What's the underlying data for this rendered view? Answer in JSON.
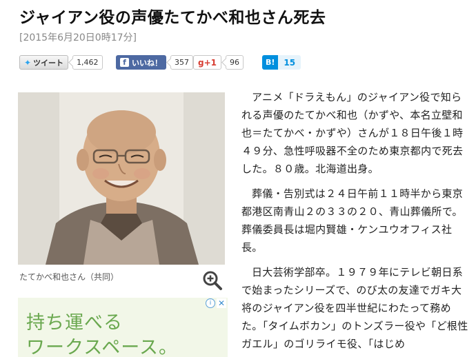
{
  "headline": "ジャイアン役の声優たてかべ和也さん死去",
  "dateline": "[2015年6月20日0時17分]",
  "share": {
    "twitter_label": "ツイート",
    "twitter_count": "1,462",
    "facebook_label": "いいね！",
    "facebook_count": "357",
    "gplus_label": "+1",
    "gplus_count": "96",
    "hatena_label": "B!",
    "hatena_count": "15"
  },
  "photo": {
    "caption": "たてかべ和也さん（共同）"
  },
  "ad": {
    "line1": "持ち運べる",
    "line2": "ワークスペース。",
    "info_icon": "i",
    "close_icon": "✕"
  },
  "article": {
    "paragraphs": [
      "アニメ「ドラえもん」のジャイアン役で知られる声優のたてかべ和也（かずや、本名立壁和也＝たてかべ・かずや）さんが１８日午後１時４９分、急性呼吸器不全のため東京都内で死去した。８０歳。北海道出身。",
      "葬儀・告別式は２４日午前１１時半から東京都港区南青山２の３３の２０、青山葬儀所で。葬儀委員長は堀内賢雄・ケンユウオフィス社長。",
      "日大芸術学部卒。１９７９年にテレビ朝日系で始まったシリーズで、のび太の友達でガキ大将のジャイアン役を四半世紀にわたって務めた。「タイムボカン」のトンズラー役や「ど根性ガエル」のゴリライモ役、「はじめ"
    ]
  },
  "colors": {
    "facebook": "#4d69a2",
    "hatena": "#008fde",
    "gplus": "#d73d32",
    "ad_text": "#6aa84f"
  },
  "icons": [
    "twitter-bird-icon",
    "facebook-f-icon",
    "zoom-in-icon",
    "ad-info-icon",
    "ad-close-icon"
  ]
}
